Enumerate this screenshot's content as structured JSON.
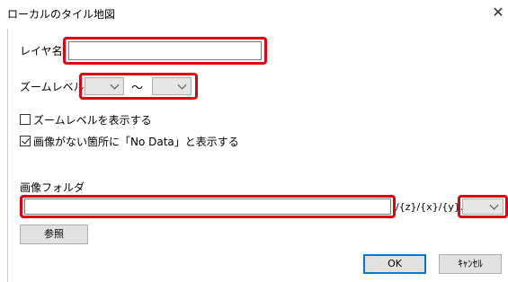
{
  "window": {
    "title": "ローカルのタイル地図",
    "close_glyph": "✕"
  },
  "layer_name": {
    "label": "レイヤ名",
    "value": ""
  },
  "zoom": {
    "label": "ズームレベル",
    "min_value": "",
    "separator": "～",
    "max_value": ""
  },
  "options": {
    "show_zoom_level": {
      "label": "ズームレベルを表示する",
      "checked": false
    },
    "show_no_data": {
      "label": "画像がない箇所に「No Data」と表示する",
      "checked": true
    }
  },
  "image_folder": {
    "label": "画像フォルダ",
    "path_value": "",
    "suffix": "/{z}/{x}/{y}.",
    "extension_value": ""
  },
  "buttons": {
    "browse": "参照",
    "ok": "OK",
    "cancel": "ｷｬﾝｾﾙ"
  },
  "colors": {
    "highlight": "#e1000f",
    "default_button_border": "#0078d7"
  }
}
